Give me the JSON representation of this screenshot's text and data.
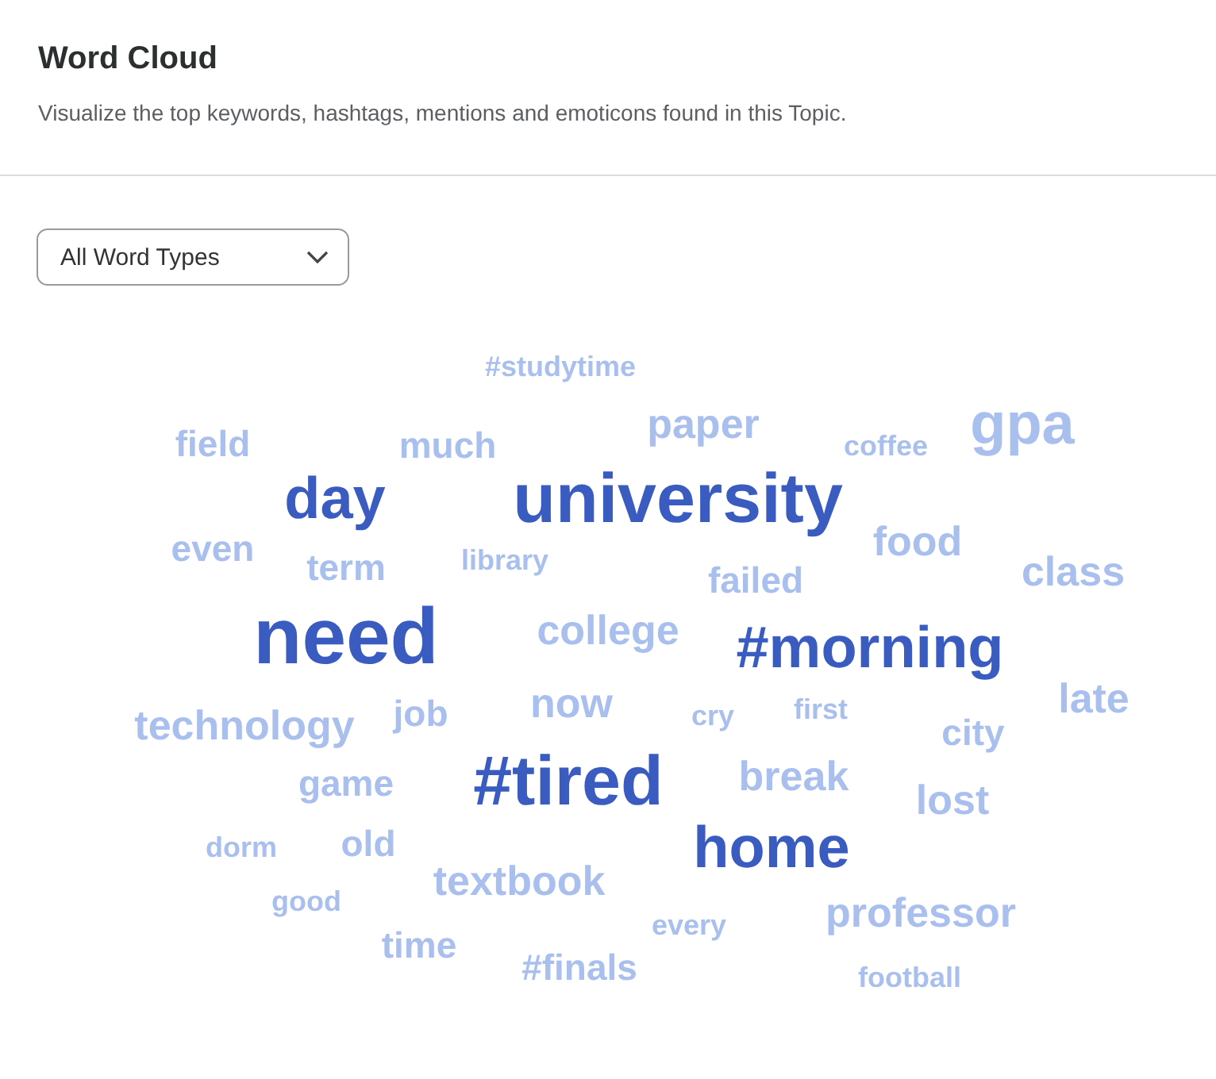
{
  "header": {
    "title": "Word Cloud",
    "subtitle": "Visualize the top keywords, hashtags, mentions and emoticons found in this Topic."
  },
  "filter": {
    "value": "All Word Types"
  },
  "words": [
    {
      "text": "#studytime",
      "kind": "tiny",
      "color": "#a9bfee"
    },
    {
      "text": "field",
      "kind": "small",
      "color": "#a9bfee"
    },
    {
      "text": "much",
      "kind": "small",
      "color": "#a9bfee"
    },
    {
      "text": "paper",
      "kind": "medium",
      "color": "#a9bfee"
    },
    {
      "text": "coffee",
      "kind": "tiny",
      "color": "#a9bfee"
    },
    {
      "text": "gpa",
      "kind": "big",
      "color": "#a9bfee"
    },
    {
      "text": "day",
      "kind": "big",
      "color": "#3a5bbf"
    },
    {
      "text": "university",
      "kind": "large",
      "color": "#3a5bbf"
    },
    {
      "text": "even",
      "kind": "small",
      "color": "#a9bfee"
    },
    {
      "text": "term",
      "kind": "small",
      "color": "#a9bfee"
    },
    {
      "text": "library",
      "kind": "tiny",
      "color": "#a9bfee"
    },
    {
      "text": "failed",
      "kind": "small",
      "color": "#a9bfee"
    },
    {
      "text": "food",
      "kind": "medium",
      "color": "#a9bfee"
    },
    {
      "text": "class",
      "kind": "medium",
      "color": "#a9bfee"
    },
    {
      "text": "need",
      "kind": "huge",
      "color": "#3a5bbf"
    },
    {
      "text": "college",
      "kind": "medium",
      "color": "#a9bfee"
    },
    {
      "text": "#morning",
      "kind": "big",
      "color": "#3a5bbf"
    },
    {
      "text": "late",
      "kind": "medium",
      "color": "#a9bfee"
    },
    {
      "text": "technology",
      "kind": "medium",
      "color": "#a9bfee"
    },
    {
      "text": "job",
      "kind": "small",
      "color": "#a9bfee"
    },
    {
      "text": "now",
      "kind": "medium",
      "color": "#a9bfee"
    },
    {
      "text": "cry",
      "kind": "tiny",
      "color": "#a9bfee"
    },
    {
      "text": "first",
      "kind": "tiny",
      "color": "#a9bfee"
    },
    {
      "text": "city",
      "kind": "small",
      "color": "#a9bfee"
    },
    {
      "text": "game",
      "kind": "small",
      "color": "#a9bfee"
    },
    {
      "text": "#tired",
      "kind": "large",
      "color": "#3a5bbf"
    },
    {
      "text": "break",
      "kind": "medium",
      "color": "#a9bfee"
    },
    {
      "text": "lost",
      "kind": "medium",
      "color": "#a9bfee"
    },
    {
      "text": "dorm",
      "kind": "tiny",
      "color": "#a9bfee"
    },
    {
      "text": "old",
      "kind": "small",
      "color": "#a9bfee"
    },
    {
      "text": "home",
      "kind": "big",
      "color": "#3a5bbf"
    },
    {
      "text": "textbook",
      "kind": "medium",
      "color": "#a9bfee"
    },
    {
      "text": "good",
      "kind": "tiny",
      "color": "#a9bfee"
    },
    {
      "text": "every",
      "kind": "tiny",
      "color": "#a9bfee"
    },
    {
      "text": "professor",
      "kind": "medium",
      "color": "#a9bfee"
    },
    {
      "text": "time",
      "kind": "small",
      "color": "#a9bfee"
    },
    {
      "text": "#finals",
      "kind": "small",
      "color": "#a9bfee"
    },
    {
      "text": "football",
      "kind": "tiny",
      "color": "#a9bfee"
    }
  ]
}
